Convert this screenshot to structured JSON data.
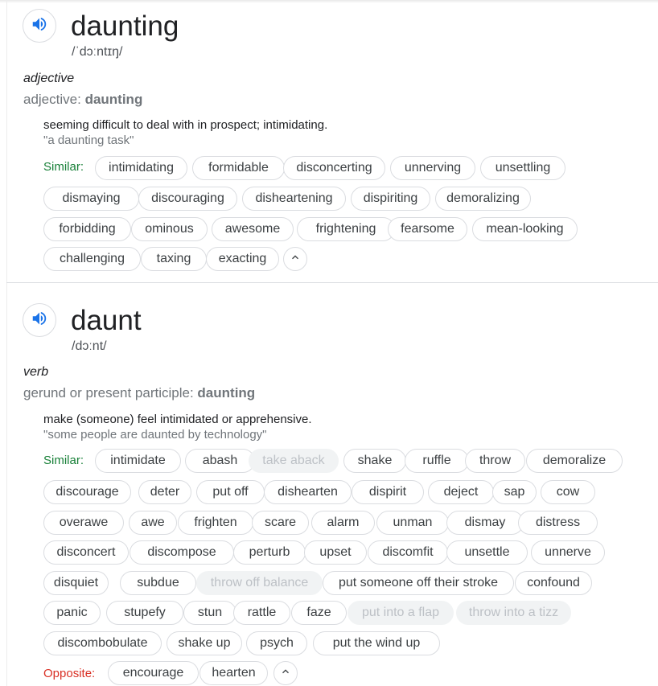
{
  "entries": [
    {
      "word": "daunting",
      "phonetic": "/ˈdɔːntɪŋ/",
      "pos": "adjective",
      "form_prefix": "adjective:",
      "form_word": "daunting",
      "definition": "seeming difficult to deal with in prospect; intimidating.",
      "example": "\"a daunting task\"",
      "similar_label": "Similar:",
      "similar": [
        "intimidating",
        "formidable",
        "disconcerting",
        "unnerving",
        "unsettling",
        "dismaying",
        "discouraging",
        "disheartening",
        "dispiriting",
        "demoralizing",
        "forbidding",
        "ominous",
        "awesome",
        "frightening",
        "fearsome",
        "mean-looking",
        "challenging",
        "taxing",
        "exacting"
      ]
    },
    {
      "word": "daunt",
      "phonetic": "/dɔːnt/",
      "pos": "verb",
      "form_prefix": "gerund or present participle:",
      "form_word": "daunting",
      "definition": "make (someone) feel intimidated or apprehensive.",
      "example": "\"some people are daunted by technology\"",
      "similar_label": "Similar:",
      "similar": [
        "intimidate",
        "abash",
        "take aback",
        "shake",
        "ruffle",
        "throw",
        "demoralize",
        "discourage",
        "deter",
        "put off",
        "dishearten",
        "dispirit",
        "deject",
        "sap",
        "cow",
        "overawe",
        "awe",
        "frighten",
        "scare",
        "alarm",
        "unman",
        "dismay",
        "distress",
        "disconcert",
        "discompose",
        "perturb",
        "upset",
        "discomfit",
        "unsettle",
        "unnerve",
        "disquiet",
        "subdue",
        "throw off balance",
        "put someone off their stroke",
        "confound",
        "panic",
        "stupefy",
        "stun",
        "rattle",
        "faze",
        "put into a flap",
        "throw into a tizz",
        "discombobulate",
        "shake up",
        "psych",
        "put the wind up"
      ],
      "disabled_chips": [
        "take aback",
        "throw off balance",
        "put into a flap",
        "throw into a tizz"
      ],
      "opposite_label": "Opposite:",
      "opposite": [
        "encourage",
        "hearten"
      ]
    }
  ],
  "icons": {
    "speaker": "speaker-icon",
    "collapse": "chevron-up-icon"
  },
  "colors": {
    "speaker_blue": "#1a73e8",
    "similar_green": "#188038",
    "opposite_red": "#d93025"
  }
}
